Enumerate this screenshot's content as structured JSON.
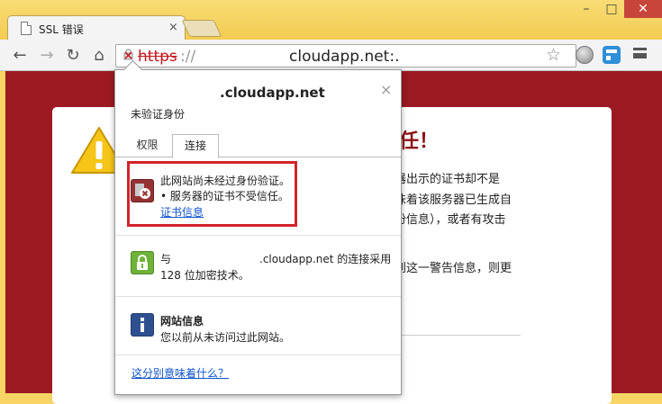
{
  "tab": {
    "title": "SSL 错误",
    "close": "×"
  },
  "window": {
    "minimize": "–",
    "maximize": "□",
    "close": "✕"
  },
  "toolbar": {
    "back": "←",
    "forward": "→",
    "reload": "↻",
    "home": "⌂",
    "url_scheme": "https",
    "url_sep": "://",
    "url_host": "cloudapp.net:.",
    "star": "☆",
    "icons": [
      "lock-error-icon",
      "star-icon",
      "globe-icon",
      "extension-icon",
      "menu-icon"
    ]
  },
  "page": {
    "title": "任！",
    "lines": [
      "器出示的证书却不是",
      "味着该服务器已生成自",
      "份信息），或者有攻击",
      "到这一警告信息，则更"
    ],
    "colors": {
      "background": "#9b1a22",
      "title": "#8c1014"
    }
  },
  "popup": {
    "host": ".cloudapp.net",
    "close": "×",
    "subtitle": "未验证身份",
    "tabs": [
      "权限",
      "连接"
    ],
    "identity": {
      "line1": "此网站尚未经过身份验证。",
      "line2": "• 服务器的证书不受信任。",
      "link": "证书信息"
    },
    "connection": {
      "prefix": "与",
      "host": ".cloudapp.net 的连接采用",
      "line2": "128 位加密技术。"
    },
    "site_info": {
      "title": "网站信息",
      "text": "您以前从未访问过此网站。"
    },
    "bottom_link": "这分别意味着什么？",
    "colors": {
      "highlight": "#d3232b",
      "link": "#1155cc"
    }
  }
}
